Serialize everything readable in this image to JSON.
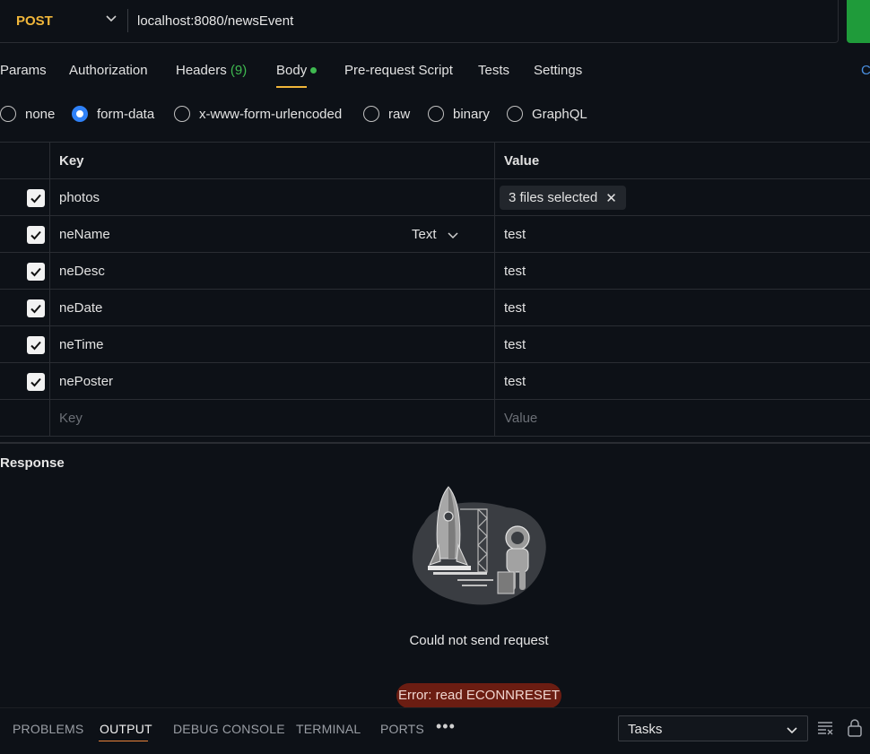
{
  "request": {
    "method": "POST",
    "url": "localhost:8080/newsEvent"
  },
  "tabs": [
    {
      "label": "Params"
    },
    {
      "label": "Authorization"
    },
    {
      "label": "Headers",
      "count": "(9)"
    },
    {
      "label": "Body"
    },
    {
      "label": "Pre-request Script"
    },
    {
      "label": "Tests"
    },
    {
      "label": "Settings"
    }
  ],
  "tab_cut_label": "C",
  "active_tab": "Body",
  "body_modes": [
    {
      "label": "none",
      "selected": false
    },
    {
      "label": "form-data",
      "selected": true
    },
    {
      "label": "x-www-form-urlencoded",
      "selected": false
    },
    {
      "label": "raw",
      "selected": false
    },
    {
      "label": "binary",
      "selected": false
    },
    {
      "label": "GraphQL",
      "selected": false
    }
  ],
  "table": {
    "headers": {
      "key": "Key",
      "value": "Value"
    },
    "rows": [
      {
        "key": "photos",
        "value": "3 files selected",
        "checked": true
      },
      {
        "key": "neName",
        "value": "test",
        "checked": true,
        "type": "Text"
      },
      {
        "key": "neDesc",
        "value": "test",
        "checked": true
      },
      {
        "key": "neDate",
        "value": "test",
        "checked": true
      },
      {
        "key": "neTime",
        "value": "test",
        "checked": true
      },
      {
        "key": "nePoster",
        "value": "test",
        "checked": true
      }
    ],
    "placeholder_key": "Key",
    "placeholder_value": "Value"
  },
  "response": {
    "title": "Response",
    "message": "Could not send request",
    "error": "Error: read ECONNRESET"
  },
  "panel": {
    "tabs": [
      "PROBLEMS",
      "OUTPUT",
      "DEBUG CONSOLE",
      "TERMINAL",
      "PORTS"
    ],
    "active": "OUTPUT",
    "more": "•••",
    "dropdown": "Tasks"
  },
  "colors": {
    "method": "#f0b63a",
    "send": "#1f9b3a",
    "accent": "#2f81f7",
    "success": "#3fb950",
    "error_bg": "#6b1d12"
  }
}
